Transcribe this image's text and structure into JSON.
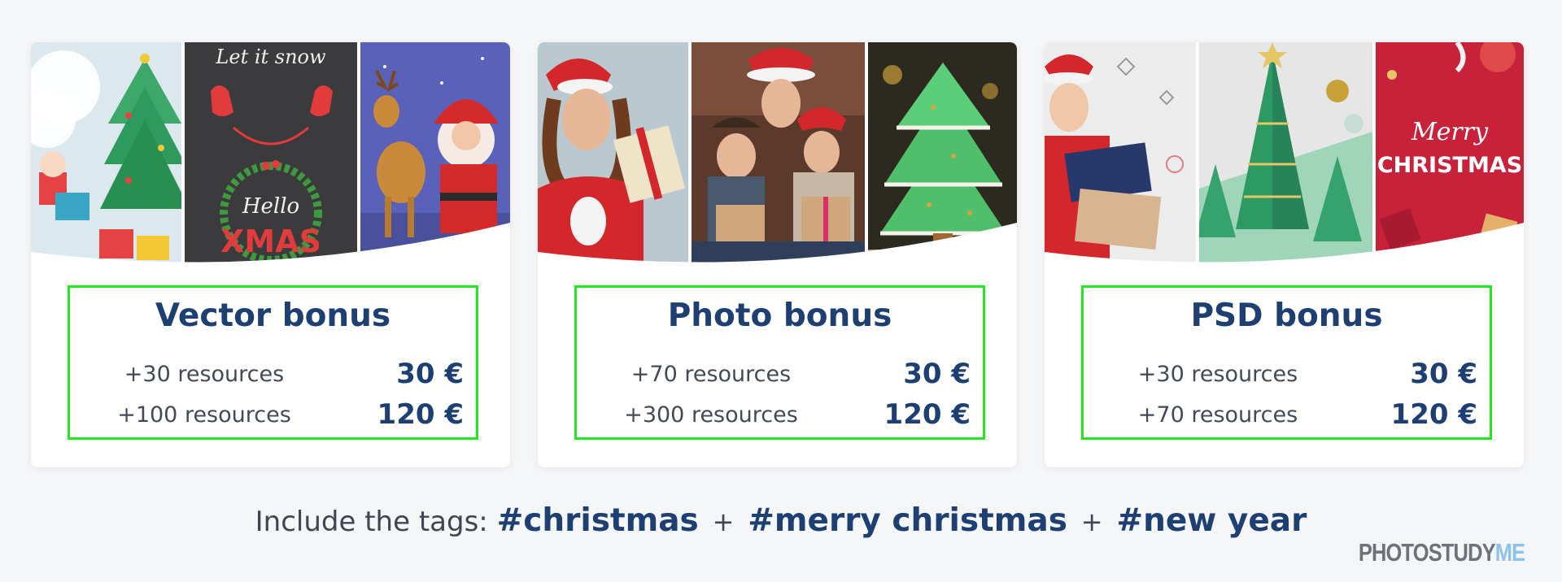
{
  "cards": [
    {
      "title": "Vector bonus",
      "rows": [
        {
          "resources": "+30 resources",
          "price": "30 €"
        },
        {
          "resources": "+100 resources",
          "price": "120 €"
        }
      ],
      "image_text": {
        "letitsnow": "Let it snow",
        "hello": "Hello",
        "xmas": "XMAS"
      }
    },
    {
      "title": "Photo bonus",
      "rows": [
        {
          "resources": "+70 resources",
          "price": "30 €"
        },
        {
          "resources": "+300 resources",
          "price": "120 €"
        }
      ]
    },
    {
      "title": "PSD bonus",
      "rows": [
        {
          "resources": "+30 resources",
          "price": "30 €"
        },
        {
          "resources": "+70 resources",
          "price": "120 €"
        }
      ],
      "image_text": {
        "merry": "Merry",
        "christmas": "CHRISTMAS"
      }
    }
  ],
  "tags": {
    "intro": "Include the tags:",
    "tag1": "#christmas",
    "tag2": "#merry christmas",
    "tag3": "#new year",
    "plus": "+"
  },
  "logo": {
    "part1": "PHOTOSTUDY",
    "part2": "ME"
  },
  "colors": {
    "background": "#f5f6f8",
    "title_blue": "#1d3f72",
    "highlight_green": "#22e822",
    "logo_gray": "#6d727a",
    "logo_blue": "#8dc2ea"
  }
}
